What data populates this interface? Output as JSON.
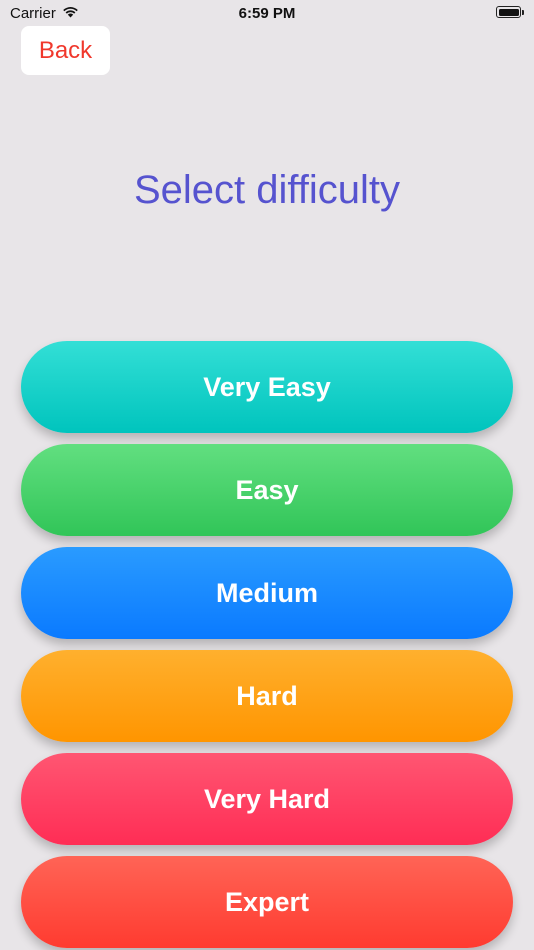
{
  "status_bar": {
    "carrier": "Carrier",
    "time": "6:59 PM",
    "wifi_icon": "wifi-icon",
    "battery_icon": "battery-icon"
  },
  "back_button": {
    "label": "Back",
    "color": "#f0382c"
  },
  "title": {
    "text": "Select difficulty",
    "color": "#5653cf"
  },
  "options": [
    {
      "label": "Very Easy",
      "color_top": "#33dfd6",
      "color_bottom": "#00c4bd"
    },
    {
      "label": "Easy",
      "color_top": "#62df80",
      "color_bottom": "#31c558"
    },
    {
      "label": "Medium",
      "color_top": "#2a9bff",
      "color_bottom": "#0a7aff"
    },
    {
      "label": "Hard",
      "color_top": "#ffb02e",
      "color_bottom": "#ff9500"
    },
    {
      "label": "Very Hard",
      "color_top": "#ff5672",
      "color_bottom": "#ff2d55"
    },
    {
      "label": "Expert",
      "color_top": "#ff6456",
      "color_bottom": "#ff3b30"
    }
  ]
}
